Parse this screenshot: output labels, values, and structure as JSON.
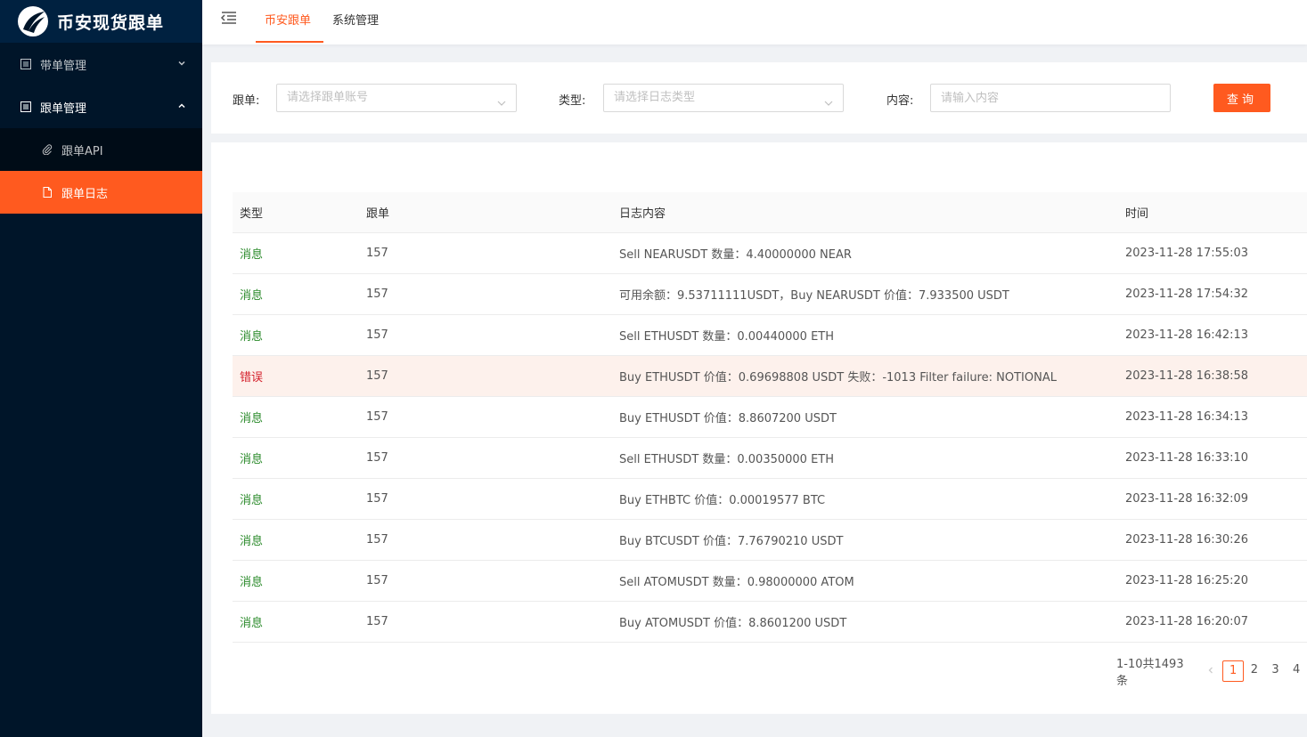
{
  "app": {
    "title": "币安现货跟单"
  },
  "sidebar": {
    "items": [
      {
        "label": "带单管理"
      },
      {
        "label": "跟单管理",
        "children": [
          {
            "label": "跟单API"
          },
          {
            "label": "跟单日志"
          }
        ]
      }
    ]
  },
  "header": {
    "tabs": [
      {
        "label": "币安跟单"
      },
      {
        "label": "系统管理"
      }
    ]
  },
  "search": {
    "follow_label": "跟单:",
    "follow_placeholder": "请选择跟单账号",
    "type_label": "类型:",
    "type_placeholder": "请选择日志类型",
    "content_label": "内容:",
    "content_placeholder": "请输入内容",
    "query_button": "查询"
  },
  "table": {
    "columns": [
      "类型",
      "跟单",
      "日志内容",
      "时间"
    ],
    "rows": [
      {
        "type": "消息",
        "follow": "157",
        "content": "Sell NEARUSDT 数量：4.40000000 NEAR",
        "time": "2023-11-28 17:55:03"
      },
      {
        "type": "消息",
        "follow": "157",
        "content": "可用余额：9.53711111USDT，Buy NEARUSDT 价值：7.933500 USDT",
        "time": "2023-11-28 17:54:32"
      },
      {
        "type": "消息",
        "follow": "157",
        "content": "Sell ETHUSDT 数量：0.00440000 ETH",
        "time": "2023-11-28 16:42:13"
      },
      {
        "type": "错误",
        "follow": "157",
        "content": "Buy ETHUSDT 价值：0.69698808 USDT 失败：-1013 Filter failure: NOTIONAL",
        "time": "2023-11-28 16:38:58"
      },
      {
        "type": "消息",
        "follow": "157",
        "content": "Buy ETHUSDT 价值：8.8607200 USDT",
        "time": "2023-11-28 16:34:13"
      },
      {
        "type": "消息",
        "follow": "157",
        "content": "Sell ETHUSDT 数量：0.00350000 ETH",
        "time": "2023-11-28 16:33:10"
      },
      {
        "type": "消息",
        "follow": "157",
        "content": "Buy ETHBTC 价值：0.00019577 BTC",
        "time": "2023-11-28 16:32:09"
      },
      {
        "type": "消息",
        "follow": "157",
        "content": "Buy BTCUSDT 价值：7.76790210 USDT",
        "time": "2023-11-28 16:30:26"
      },
      {
        "type": "消息",
        "follow": "157",
        "content": "Sell ATOMUSDT 数量：0.98000000 ATOM",
        "time": "2023-11-28 16:25:20"
      },
      {
        "type": "消息",
        "follow": "157",
        "content": "Buy ATOMUSDT 价值：8.8601200 USDT",
        "time": "2023-11-28 16:20:07"
      }
    ]
  },
  "pagination": {
    "total": "1-10共1493条",
    "pages": [
      "1",
      "2",
      "3",
      "4"
    ],
    "current": "1"
  },
  "colors": {
    "accent": "#ff5a1f",
    "sidebar": "#001529",
    "info": "#2a8a2a",
    "error": "#d4202b"
  }
}
